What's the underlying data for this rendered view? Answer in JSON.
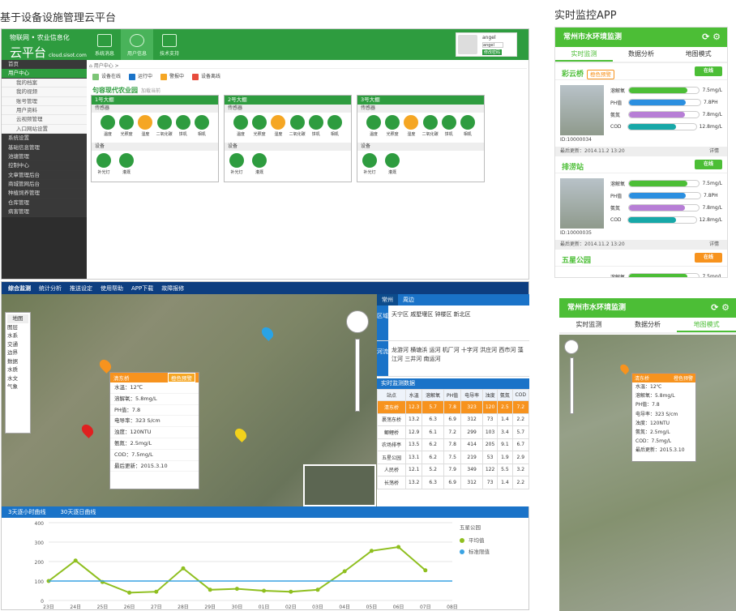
{
  "headings": {
    "left": "基于设备设施管理云平台",
    "right": "实时监控APP"
  },
  "platform": {
    "brand_top": "物联网 • 农业信息化",
    "brand_main": "云平台",
    "brand_url": "cloud.sisot.com",
    "nav": [
      "系统消息",
      "用户信息",
      "技术支持"
    ],
    "user": {
      "name": "angel",
      "role": "angel",
      "action": "修改密码"
    },
    "sidebar": [
      {
        "label": "首页",
        "type": "hd"
      },
      {
        "label": "用户中心",
        "type": "on"
      },
      {
        "label": "我的档案",
        "type": "sub"
      },
      {
        "label": "我的视频",
        "type": "sub"
      },
      {
        "label": "账号管理",
        "type": "sub"
      },
      {
        "label": "用户资料",
        "type": "sub"
      },
      {
        "label": "云视频管理",
        "type": "sub"
      },
      {
        "label": "入口网站设置",
        "type": "sub"
      },
      {
        "label": "系统设置",
        "type": "hd"
      },
      {
        "label": "基础信息管理",
        "type": "hd"
      },
      {
        "label": "池塘管理",
        "type": "hd"
      },
      {
        "label": "控制中心",
        "type": "hd"
      },
      {
        "label": "文章管理后台",
        "type": "hd"
      },
      {
        "label": "商城管网后台",
        "type": "hd"
      },
      {
        "label": "种植饲养管理",
        "type": "hd"
      },
      {
        "label": "仓库管理",
        "type": "hd"
      },
      {
        "label": "病害管理",
        "type": "hd"
      }
    ],
    "breadcrumb": "用户中心 >",
    "legend": [
      {
        "label": "设备在线",
        "color": "#7cc576"
      },
      {
        "label": "运行中",
        "color": "#1a73c8"
      },
      {
        "label": "警报中",
        "color": "#f5a623"
      },
      {
        "label": "设备离线",
        "color": "#e74c3c"
      }
    ],
    "farm": {
      "name": "句容现代农业园",
      "hint": "加载当前"
    },
    "sheds": [
      {
        "title": "1号大棚"
      },
      {
        "title": "2号大棚"
      },
      {
        "title": "3号大棚"
      }
    ],
    "shed_sensor_label": "传感器",
    "shed_device_label": "设备",
    "sensors": [
      "温度",
      "光照度",
      "湿度",
      "二氧化碳",
      "饼机",
      "相机"
    ],
    "devices": [
      "补光灯",
      "灌溉"
    ]
  },
  "monitor": {
    "nav": [
      "综合监测",
      "统计分析",
      "推送设定",
      "使用帮助",
      "APP下载",
      "故障报修"
    ],
    "layers": {
      "title": "地图",
      "items": [
        "图层",
        "水系",
        "交通",
        "边界",
        "数据",
        "水质",
        "水文",
        "气象"
      ]
    },
    "popup": {
      "title": "清东桥",
      "badge": "橙色预警",
      "rows": [
        "水温：12℃",
        "溶解氧：5.8mg/L",
        "PH值：7.8",
        "电导率：323 S/cm",
        "浊度：120NTU",
        "氨氮：2.5mg/L",
        "COD：7.5mg/L",
        "最后更新：2015.3.10"
      ]
    },
    "info_tabs": [
      "常州",
      "周边"
    ],
    "region_label": "区域",
    "regions": "天宁区 戚墅堰区 钟楼区 新北区",
    "river_label": "河流",
    "rivers": "龙游河 横塘浜 运河 机厂河 十字河 洪庄河 西市河 藻江河 三井河 南运河",
    "realtime_title": "实时监测数据",
    "table": {
      "head": [
        "站点",
        "水温",
        "溶解氧",
        "PH值",
        "电导率",
        "浊度",
        "氨氮",
        "COD"
      ],
      "rows": [
        [
          "清东桥",
          "12.3",
          "5.7",
          "7.8",
          "323",
          "120",
          "2.5",
          "7.2"
        ],
        [
          "裹荡东桥",
          "13.2",
          "6.3",
          "6.9",
          "312",
          "73",
          "1.4",
          "2.2"
        ],
        [
          "鲫鲤桥",
          "12.9",
          "6.1",
          "7.2",
          "299",
          "103",
          "3.4",
          "5.7"
        ],
        [
          "农场排亭",
          "13.5",
          "6.2",
          "7.8",
          "414",
          "205",
          "9.1",
          "6.7"
        ],
        [
          "五星公园",
          "13.1",
          "6.2",
          "7.5",
          "219",
          "53",
          "1.9",
          "2.9"
        ],
        [
          "人民桥",
          "12.1",
          "5.2",
          "7.9",
          "349",
          "122",
          "5.5",
          "3.2"
        ],
        [
          "长荡桥",
          "13.2",
          "6.3",
          "6.9",
          "312",
          "73",
          "1.4",
          "2.2"
        ]
      ]
    },
    "chart_tabs": [
      "3天逐小时曲线",
      "30天逐日曲线"
    ]
  },
  "chart_data": {
    "type": "line",
    "categories": [
      "23日",
      "24日",
      "25日",
      "26日",
      "27日",
      "28日",
      "29日",
      "30日",
      "01日",
      "02日",
      "03日",
      "04日",
      "05日",
      "06日",
      "07日",
      "08日"
    ],
    "series": [
      {
        "name": "平均值",
        "values": [
          100,
          205,
          95,
          40,
          45,
          165,
          55,
          60,
          50,
          45,
          55,
          150,
          255,
          275,
          155,
          null
        ]
      },
      {
        "name": "标准限值",
        "values": [
          100,
          100,
          100,
          100,
          100,
          100,
          100,
          100,
          100,
          100,
          100,
          100,
          100,
          100,
          100,
          100
        ]
      }
    ],
    "legend_title": "五星公园",
    "ylim": [
      0,
      400
    ],
    "yticks": [
      0,
      100,
      200,
      300,
      400
    ],
    "colors": [
      "#8fbf1f",
      "#3aa3e3"
    ]
  },
  "app": {
    "title": "常州市水环境监测",
    "tabs": [
      "实时监测",
      "数据分析",
      "地图模式"
    ],
    "stations": [
      {
        "name": "彩云桥",
        "badge": "橙色预警",
        "online": "在线",
        "id": "ID:10000034",
        "update": "最后更新：2014.11.2  13:20",
        "detail": "详情",
        "bars": [
          {
            "n": "溶解氧",
            "v": "7.5mg/L",
            "f": 0.83,
            "c": "#4cbe36"
          },
          {
            "n": "PH值",
            "v": "7.8PH",
            "f": 0.8,
            "c": "#2b8fe0"
          },
          {
            "n": "氨氮",
            "v": "7.8mg/L",
            "f": 0.8,
            "c": "#b77ed6"
          },
          {
            "n": "COD",
            "v": "12.8mg/L",
            "f": 0.7,
            "c": "#17a8a8"
          }
        ]
      },
      {
        "name": "排涝站",
        "badge": "",
        "online": "在线",
        "id": "ID:10000035",
        "update": "最后更新：2014.11.2  13:20",
        "detail": "详情",
        "bars": [
          {
            "n": "溶解氧",
            "v": "7.5mg/L",
            "f": 0.83,
            "c": "#4cbe36"
          },
          {
            "n": "PH值",
            "v": "7.8PH",
            "f": 0.8,
            "c": "#2b8fe0"
          },
          {
            "n": "氨氮",
            "v": "7.8mg/L",
            "f": 0.8,
            "c": "#b77ed6"
          },
          {
            "n": "COD",
            "v": "12.8mg/L",
            "f": 0.7,
            "c": "#17a8a8"
          }
        ]
      },
      {
        "name": "五星公园",
        "badge": "",
        "online": "在线",
        "bars": [
          {
            "n": "溶解氧",
            "v": "7.5mg/L",
            "f": 0.83,
            "c": "#4cbe36"
          }
        ]
      }
    ],
    "map_popup": {
      "title": "清东桥",
      "badge": "橙色预警",
      "rows": [
        "水温：12℃",
        "溶解氧：5.8mg/L",
        "PH值：7.8",
        "电导率：323 S/cm",
        "浊度：120NTU",
        "氨氮：2.5mg/L",
        "COD：7.5mg/L",
        "最后更新：2015.3.10"
      ]
    }
  }
}
